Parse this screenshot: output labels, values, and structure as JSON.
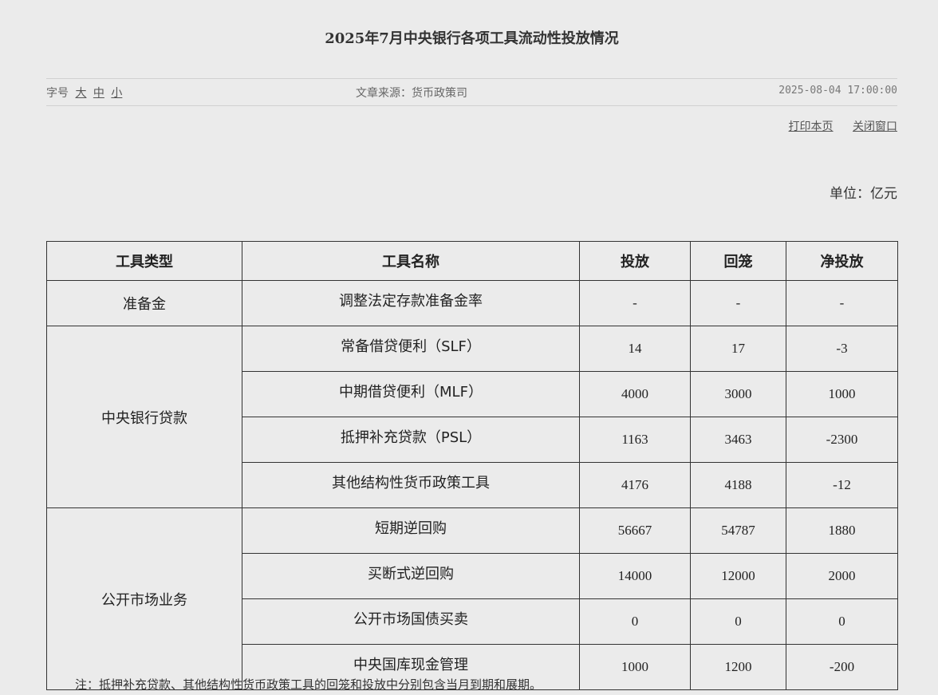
{
  "title": "2025年7月中央银行各项工具流动性投放情况",
  "info": {
    "font_size_label": "字号",
    "font_sizes": [
      "大",
      "中",
      "小"
    ],
    "source": "文章来源：货币政策司",
    "datetime": "2025-08-04 17:00:00"
  },
  "actions": {
    "print": "打印本页",
    "close": "关闭窗口"
  },
  "unit": "单位：亿元",
  "table": {
    "headers": [
      "工具类型",
      "工具名称",
      "投放",
      "回笼",
      "净投放"
    ],
    "groups": [
      {
        "type": "准备金",
        "rows": [
          {
            "name": "调整法定存款准备金率",
            "inject": "-",
            "withdraw": "-",
            "net": "-"
          }
        ]
      },
      {
        "type": "中央银行贷款",
        "rows": [
          {
            "name": "常备借贷便利（SLF）",
            "inject": "14",
            "withdraw": "17",
            "net": "-3"
          },
          {
            "name": "中期借贷便利（MLF）",
            "inject": "4000",
            "withdraw": "3000",
            "net": "1000"
          },
          {
            "name": "抵押补充贷款（PSL）",
            "inject": "1163",
            "withdraw": "3463",
            "net": "-2300"
          },
          {
            "name": "其他结构性货币政策工具",
            "inject": "4176",
            "withdraw": "4188",
            "net": "-12"
          }
        ]
      },
      {
        "type": "公开市场业务",
        "rows": [
          {
            "name": "短期逆回购",
            "inject": "56667",
            "withdraw": "54787",
            "net": "1880"
          },
          {
            "name": "买断式逆回购",
            "inject": "14000",
            "withdraw": "12000",
            "net": "2000"
          },
          {
            "name": "公开市场国债买卖",
            "inject": "0",
            "withdraw": "0",
            "net": "0"
          },
          {
            "name": "中央国库现金管理",
            "inject": "1000",
            "withdraw": "1200",
            "net": "-200"
          }
        ]
      }
    ]
  },
  "note": "注：抵押补充贷款、其他结构性货币政策工具的回笼和投放中分别包含当月到期和展期。"
}
